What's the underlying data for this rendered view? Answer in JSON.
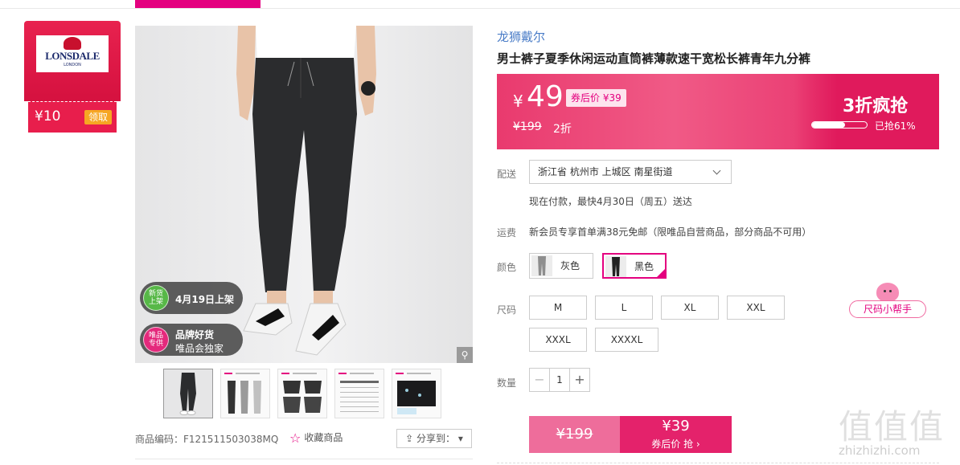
{
  "coupon": {
    "brand": "LONSDALE",
    "brand_sub": "LONDON",
    "amount": "¥10",
    "get_label": "领取"
  },
  "gallery": {
    "badge_new_icon": "新货\n上架",
    "badge_new_text": "4月19日上架",
    "badge_vip_icon": "唯品\n专供",
    "badge_vip_line1": "品牌好货",
    "badge_vip_line2": "唯品会独家",
    "zoom_icon": "magnifier-icon",
    "thumbnail_count": 5
  },
  "meta": {
    "sku": "商品编码：F121511503038MQ",
    "favorite": "收藏商品",
    "share": "分享到："
  },
  "product": {
    "brand": "龙狮戴尔",
    "title": "男士裤子夏季休闲运动直筒裤薄款速干宽松长裤青年九分裤"
  },
  "price": {
    "currency": "¥",
    "current": "49",
    "after_coupon": "券后价 ¥39",
    "original": "¥199",
    "discount": "2折",
    "promo": "3折疯抢",
    "sold_percent": 61,
    "sold_text": "已抢61%"
  },
  "delivery": {
    "label": "配送",
    "address": "浙江省 杭州市 上城区 南星街道",
    "eta": "现在付款，最快4月30日（周五）送达"
  },
  "shipping": {
    "label": "运费",
    "text": "新会员专享首单满38元免邮（限唯品自营商品，部分商品不可用）"
  },
  "color": {
    "label": "颜色",
    "options": [
      "灰色",
      "黑色"
    ],
    "selected": "黑色"
  },
  "size": {
    "label": "尺码",
    "options": [
      "M",
      "L",
      "XL",
      "XXL",
      "XXXL",
      "XXXXL"
    ],
    "helper": "尺码小帮手"
  },
  "quantity": {
    "label": "数量",
    "value": "1",
    "minus": "−",
    "plus": "+"
  },
  "buy": {
    "original": "¥199",
    "coupon_price": "¥39",
    "coupon_label": "券后价 抢 ›"
  },
  "watermark": {
    "chars": "值值值",
    "url": "zhizhizhi.com"
  }
}
